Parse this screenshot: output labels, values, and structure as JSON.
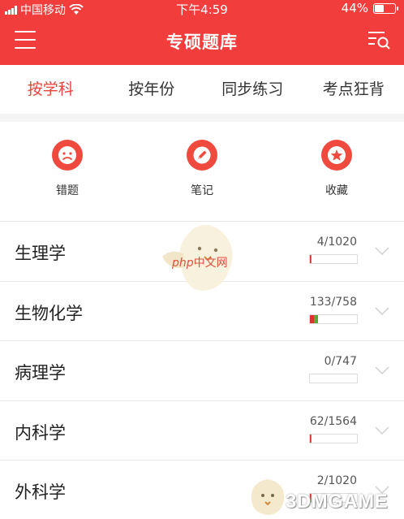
{
  "status_bar": {
    "carrier": "中国移动",
    "time": "下午4:59",
    "battery": "44%",
    "battery_level": 0.44
  },
  "header": {
    "title": "专硕题库",
    "menu_icon": "menu-icon",
    "search_icon": "list-search-icon",
    "background_color": "#f23d3d"
  },
  "tabs": [
    {
      "label": "按学科",
      "active": true
    },
    {
      "label": "按年份",
      "active": false
    },
    {
      "label": "同步练习",
      "active": false
    },
    {
      "label": "考点狂背",
      "active": false
    }
  ],
  "quick_actions": [
    {
      "label": "错题",
      "icon": "sad-face-icon"
    },
    {
      "label": "笔记",
      "icon": "pencil-icon"
    },
    {
      "label": "收藏",
      "icon": "star-icon"
    }
  ],
  "subjects": [
    {
      "name": "生理学",
      "progress": "4/1020",
      "fraction": 0.004
    },
    {
      "name": "生物化学",
      "progress": "133/758",
      "fraction": 0.175
    },
    {
      "name": "病理学",
      "progress": "0/747",
      "fraction": 0
    },
    {
      "name": "内科学",
      "progress": "62/1564",
      "fraction": 0.04
    },
    {
      "name": "外科学",
      "progress": "2/1020",
      "fraction": 0.002
    }
  ],
  "watermarks": {
    "php_text": "中文网",
    "php_prefix": "php",
    "game_text": "3DMGAME"
  },
  "colors": {
    "accent": "#e8443a",
    "progress_red": "#d9362c",
    "progress_green": "#5aa83a"
  }
}
